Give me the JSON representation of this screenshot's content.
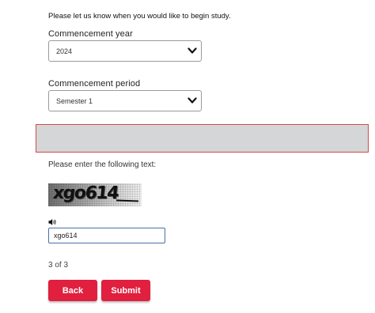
{
  "intro_text": "Please let us know when you would like to begin study.",
  "commencement_year": {
    "label": "Commencement year",
    "selected": "2024",
    "icon": "chevron-down-icon"
  },
  "commencement_period": {
    "label": "Commencement period",
    "selected": "Semester 1",
    "icon": "chevron-down-icon"
  },
  "error_banner": {
    "text": "",
    "border_color": "#d24a4a",
    "background": "#d5d6d7"
  },
  "captcha": {
    "label": "Please enter the following text:",
    "image_text": "xgo614",
    "audio_icon": "speaker-icon",
    "input_value": "xgo614"
  },
  "progress": {
    "step_text": "3 of 3"
  },
  "buttons": {
    "back_label": "Back",
    "submit_label": "Submit",
    "color": "#e0203e"
  }
}
